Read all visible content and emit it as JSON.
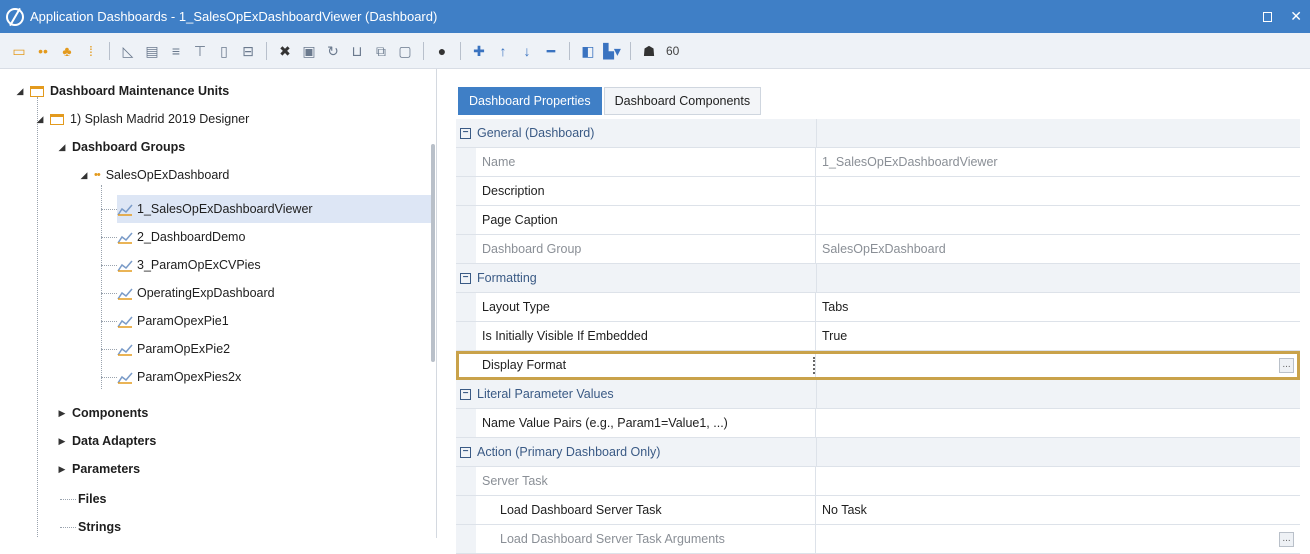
{
  "window": {
    "title": "Application Dashboards - 1_SalesOpExDashboardViewer (Dashboard)",
    "restore_icon": "restore-icon",
    "close_glyph": "✕"
  },
  "toolbar": {
    "label_60": "60"
  },
  "tree": {
    "root": "Dashboard Maintenance Units",
    "unit": "1) Splash Madrid 2019 Designer",
    "groups": "Dashboard Groups",
    "group": "SalesOpExDashboard",
    "dashboards": [
      "1_SalesOpExDashboardViewer",
      "2_DashboardDemo",
      "3_ParamOpExCVPies",
      "OperatingExpDashboard",
      "ParamOpexPie1",
      "ParamOpExPie2",
      "ParamOpexPies2x"
    ],
    "components": "Components",
    "data_adapters": "Data Adapters",
    "parameters": "Parameters",
    "files": "Files",
    "strings": "Strings"
  },
  "tabs": {
    "properties": "Dashboard Properties",
    "components": "Dashboard Components"
  },
  "grid": {
    "general": "General (Dashboard)",
    "name_label": "Name",
    "name_value": "1_SalesOpExDashboardViewer",
    "description_label": "Description",
    "page_caption_label": "Page Caption",
    "group_label": "Dashboard Group",
    "group_value": "SalesOpExDashboard",
    "formatting": "Formatting",
    "layout_label": "Layout Type",
    "layout_value": "Tabs",
    "visible_label": "Is Initially Visible If Embedded",
    "visible_value": "True",
    "display_label": "Display Format",
    "literal": "Literal Parameter Values",
    "pairs_label": "Name Value Pairs (e.g., Param1=Value1, ...)",
    "action": "Action (Primary Dashboard Only)",
    "server_task": "Server Task",
    "load_task_label": "Load Dashboard Server Task",
    "load_task_value": "No Task",
    "load_args_label": "Load Dashboard Server Task Arguments",
    "ellipsis": "..."
  },
  "colors": {
    "titlebar": "#3f7fc6",
    "accent_orange": "#e39a1d",
    "highlight": "#c9a24a"
  }
}
